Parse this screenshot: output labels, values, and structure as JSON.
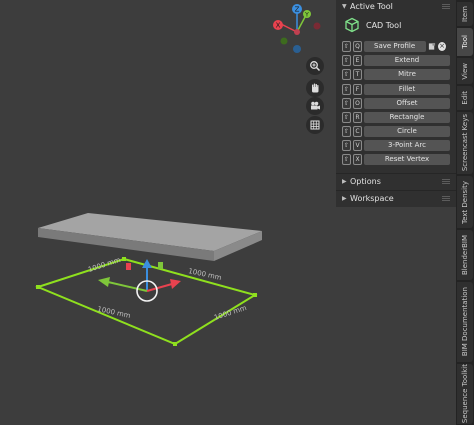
{
  "panel": {
    "header": "Active Tool",
    "tool_name": "CAD Tool",
    "tools": [
      {
        "key": "Q",
        "label": "Save Profile"
      },
      {
        "key": "E",
        "label": "Extend"
      },
      {
        "key": "T",
        "label": "Mitre"
      },
      {
        "key": "F",
        "label": "Fillet"
      },
      {
        "key": "O",
        "label": "Offset"
      },
      {
        "key": "R",
        "label": "Rectangle"
      },
      {
        "key": "C",
        "label": "Circle"
      },
      {
        "key": "V",
        "label": "3-Point Arc"
      },
      {
        "key": "X",
        "label": "Reset Vertex"
      }
    ],
    "close_glyph": "×",
    "options_label": "Options",
    "workspace_label": "Workspace"
  },
  "tabs": [
    "Item",
    "Tool",
    "View",
    "Edit",
    "Screencast Keys",
    "Text Density",
    "BlenderBIM",
    "BIM Documentation",
    "Sequence Toolkit"
  ],
  "gizmo": {
    "z_label": "Z",
    "y_label": "Y",
    "x_label": "X"
  },
  "viewport": {
    "dimensions": {
      "left_edge": "1000 mm",
      "top_edge": "1000 mm",
      "bottom_edge": "1000 mm",
      "right_edge": "1000 mm"
    }
  },
  "colors": {
    "axis_x": "#e8424f",
    "axis_y": "#7fc63a",
    "axis_z": "#3b8fe0",
    "selection": "#8fe01e",
    "slab": "#9a9a9a"
  }
}
